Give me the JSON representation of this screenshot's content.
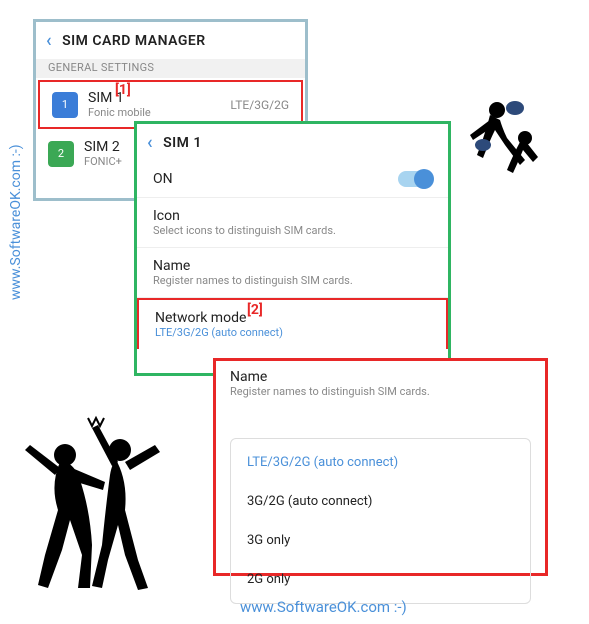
{
  "watermark": "www.SoftwareOK.com :-)",
  "panel1": {
    "title": "SIM CARD MANAGER",
    "section": "GENERAL SETTINGS",
    "annot": "[1]",
    "sim1": {
      "num": "1",
      "title": "SIM 1",
      "sub": "Fonic mobile",
      "right": "LTE/3G/2G"
    },
    "sim2": {
      "num": "2",
      "title": "SIM 2",
      "sub": "FONIC+"
    }
  },
  "panel2": {
    "title": "SIM 1",
    "annot": "[2]",
    "rows": {
      "on": "ON",
      "icon_title": "Icon",
      "icon_sub": "Select icons to distinguish SIM cards.",
      "name_title": "Name",
      "name_sub": "Register names to distinguish SIM cards.",
      "network_title": "Network mode",
      "network_sub": "LTE/3G/2G (auto connect)"
    }
  },
  "panel3": {
    "name_title": "Name",
    "name_sub": "Register names to distinguish SIM cards.",
    "options": {
      "o1": "LTE/3G/2G (auto connect)",
      "o2": "3G/2G (auto connect)",
      "o3": "3G only",
      "o4": "2G only"
    }
  }
}
